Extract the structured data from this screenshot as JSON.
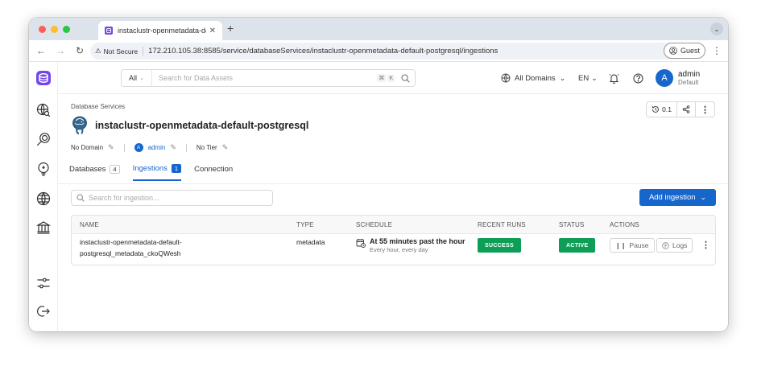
{
  "browser": {
    "tab_title": "instaclustr-openmetadata-de",
    "security_label": "Not Secure",
    "url": "172.210.105.38:8585/service/databaseServices/instaclustr-openmetadata-default-postgresql/ingestions",
    "profile_label": "Guest"
  },
  "header": {
    "search_scope": "All",
    "search_placeholder": "Search for Data Assets",
    "shortcut_key1": "⌘",
    "shortcut_key2": "K",
    "domain_label": "All Domains",
    "language": "EN",
    "user": {
      "avatar_letter": "A",
      "name": "admin",
      "role": "Default"
    }
  },
  "page": {
    "breadcrumb": "Database Services",
    "title": "instaclustr-openmetadata-default-postgresql",
    "domain": "No Domain",
    "owner_letter": "A",
    "owner": "admin",
    "tier": "No Tier",
    "version": "0.1"
  },
  "tabs": [
    {
      "label": "Databases",
      "count": "4"
    },
    {
      "label": "Ingestions",
      "count": "1"
    },
    {
      "label": "Connection"
    }
  ],
  "ingestion": {
    "search_placeholder": "Search for ingestion...",
    "add_button": "Add ingestion",
    "columns": [
      "NAME",
      "TYPE",
      "SCHEDULE",
      "RECENT RUNS",
      "STATUS",
      "ACTIONS"
    ],
    "row": {
      "name_line1": "instaclustr-openmetadata-default-",
      "name_line2": "postgresql_metadata_ckoQWesh",
      "type": "metadata",
      "schedule_main": "At 55 minutes past the hour",
      "schedule_sub": "Every hour, every day",
      "recent_run": "SUCCESS",
      "status": "ACTIVE",
      "pause_label": "Pause",
      "logs_label": "Logs"
    }
  },
  "colors": {
    "brand": "#7147e8",
    "primary": "#1766cc",
    "success": "#0e9f57"
  }
}
